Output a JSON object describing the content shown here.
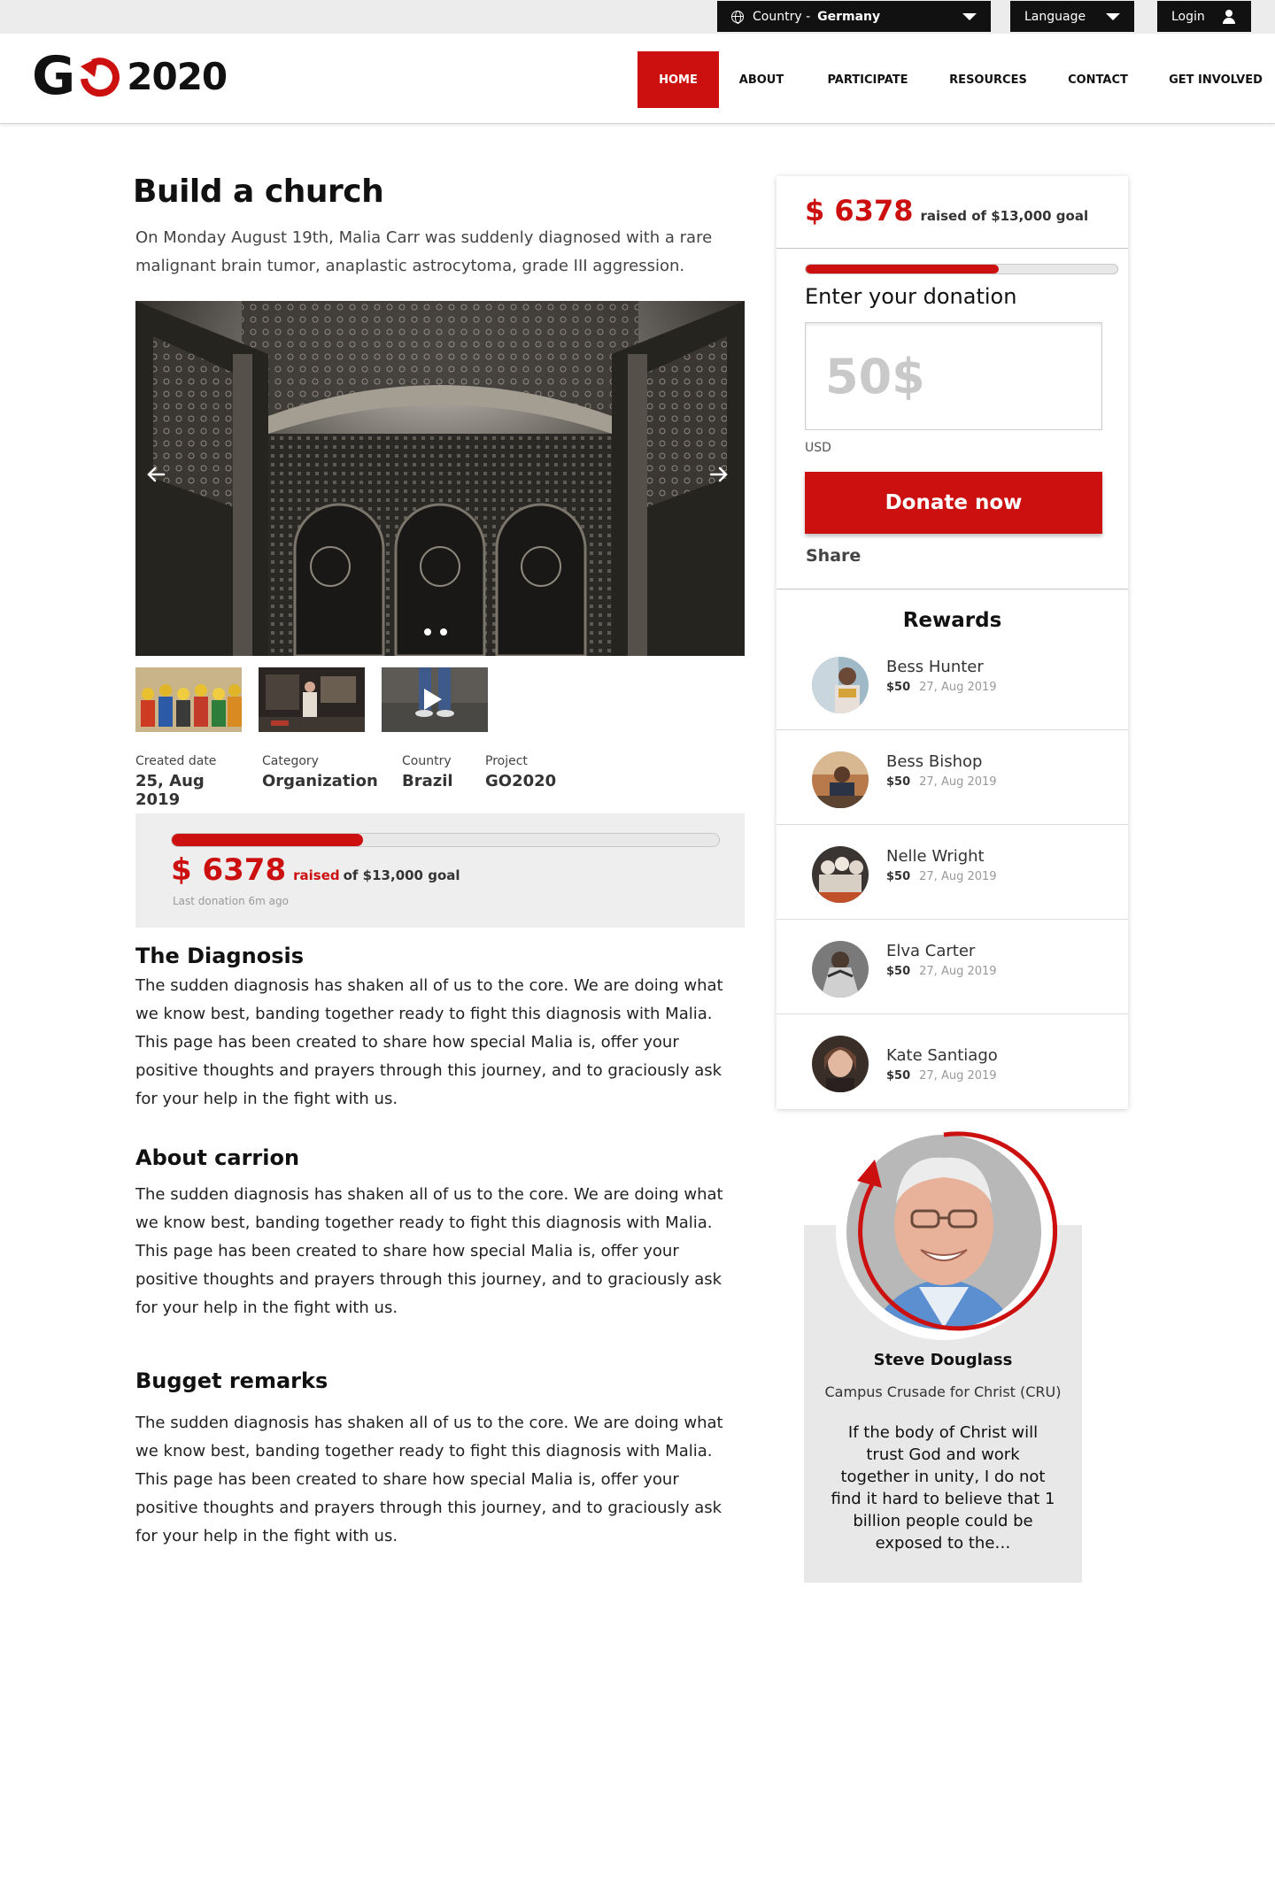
{
  "topbar": {
    "country_prefix": "Country -",
    "country_value": "Germany",
    "language_label": "Language",
    "login_label": "Login"
  },
  "header": {
    "logo_text": "G",
    "logo_year": "2020",
    "nav": [
      {
        "label": "HOME",
        "active": true
      },
      {
        "label": "ABOUT"
      },
      {
        "label": "PARTICIPATE"
      },
      {
        "label": "RESOURCES"
      },
      {
        "label": "CONTACT"
      },
      {
        "label": "GET INVOLVED"
      }
    ]
  },
  "project": {
    "title": "Build a church",
    "intro": "On Monday August 19th, Malia  Carr was suddenly diagnosed with a rare malignant brain tumor, anaplastic astrocytoma, grade III aggression.",
    "meta": [
      {
        "label": "Created date",
        "value": "25, Aug 2019"
      },
      {
        "label": "Category",
        "value": "Organization"
      },
      {
        "label": "Country",
        "value": "Brazil"
      },
      {
        "label": "Project",
        "value": "GO2020"
      }
    ]
  },
  "progress": {
    "amount": "$ 6378",
    "raised_word": "raised",
    "goal_text": "of $13,000 goal",
    "last_donation": "Last donation 6m ago",
    "fraction": 0.35
  },
  "sections": [
    {
      "heading": "The Diagnosis",
      "body": "The sudden diagnosis has shaken all of us to the core. We are doing what we know best, banding together ready to fight this diagnosis with Malia. This page has been created to share how special Malia is, offer your positive thoughts and prayers through this journey, and to graciously ask for your help in the fight with us."
    },
    {
      "heading": "About carrion",
      "body": "The sudden diagnosis has shaken all of us to the core. We are doing what we know best, banding together ready to fight this diagnosis with Malia. This page has been created to share how special Malia is, offer your positive thoughts and prayers through this journey, and to graciously ask for your help in the fight with us."
    },
    {
      "heading": "Bugget remarks",
      "body": "The sudden diagnosis has shaken all of us to the core. We are doing what we know best, banding together ready to fight this diagnosis with Malia. This page has been created to share how special Malia is, offer your positive thoughts and prayers through this journey, and to graciously ask for your help in the fight with us."
    }
  ],
  "donation": {
    "amount": "$ 6378",
    "raised_text": "raised of $13,000 goal",
    "fraction": 0.62,
    "enter_label": "Enter your donation",
    "input_placeholder": "50$",
    "currency": "USD",
    "button_label": "Donate now",
    "share_label": "Share"
  },
  "rewards": {
    "title": "Rewards",
    "items": [
      {
        "name": "Bess Hunter",
        "amount": "$50",
        "date": "27, Aug 2019"
      },
      {
        "name": "Bess Bishop",
        "amount": "$50",
        "date": "27, Aug 2019"
      },
      {
        "name": "Nelle Wright",
        "amount": "$50",
        "date": "27, Aug 2019"
      },
      {
        "name": "Elva Carter",
        "amount": "$50",
        "date": "27, Aug 2019"
      },
      {
        "name": "Kate Santiago",
        "amount": "$50",
        "date": "27, Aug 2019"
      }
    ]
  },
  "testimonial": {
    "name": "Steve Douglass",
    "org": "Campus Crusade for Christ (CRU)",
    "quote": "If the body of Christ will trust God and work together in unity, I do not find it hard to believe that 1 billion people could be exposed to the…"
  },
  "colors": {
    "brand_red": "#cc1010",
    "dark": "#111111",
    "panel_gray": "#eeeeee"
  }
}
